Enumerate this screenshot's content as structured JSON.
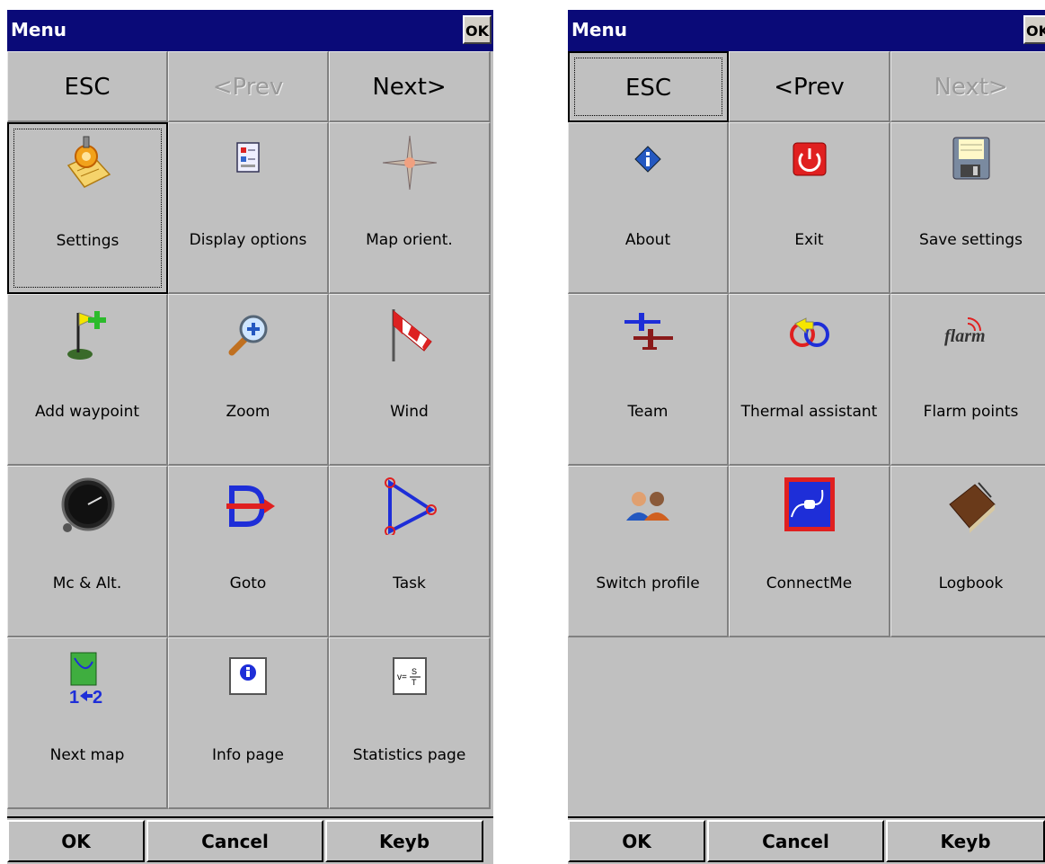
{
  "left": {
    "title": "Menu",
    "ok": "OK",
    "nav": {
      "esc": "ESC",
      "prev": "<Prev",
      "next": "Next>"
    },
    "items": [
      {
        "label": "Settings",
        "icon": "settings-icon"
      },
      {
        "label": "Display options",
        "icon": "display-options-icon"
      },
      {
        "label": "Map orient.",
        "icon": "compass-icon"
      },
      {
        "label": "Add waypoint",
        "icon": "add-waypoint-icon"
      },
      {
        "label": "Zoom",
        "icon": "zoom-icon"
      },
      {
        "label": "Wind",
        "icon": "windsock-icon"
      },
      {
        "label": "Mc & Alt.",
        "icon": "gauge-icon"
      },
      {
        "label": "Goto",
        "icon": "goto-icon"
      },
      {
        "label": "Task",
        "icon": "task-icon"
      },
      {
        "label": "Next map",
        "icon": "next-map-icon"
      },
      {
        "label": "Info page",
        "icon": "info-page-icon"
      },
      {
        "label": "Statistics page",
        "icon": "statistics-icon"
      }
    ],
    "bottom": {
      "ok": "OK",
      "cancel": "Cancel",
      "keyb": "Keyb"
    }
  },
  "right": {
    "title": "Menu",
    "ok": "OK",
    "nav": {
      "esc": "ESC",
      "prev": "<Prev",
      "next": "Next>"
    },
    "items": [
      {
        "label": "About",
        "icon": "about-icon"
      },
      {
        "label": "Exit",
        "icon": "power-icon"
      },
      {
        "label": "Save settings",
        "icon": "floppy-icon"
      },
      {
        "label": "Team",
        "icon": "team-icon"
      },
      {
        "label": "Thermal assistant",
        "icon": "thermal-assistant-icon"
      },
      {
        "label": "Flarm points",
        "icon": "flarm-icon"
      },
      {
        "label": "Switch profile",
        "icon": "profile-icon"
      },
      {
        "label": "ConnectMe",
        "icon": "connect-icon"
      },
      {
        "label": "Logbook",
        "icon": "logbook-icon"
      }
    ],
    "bottom": {
      "ok": "OK",
      "cancel": "Cancel",
      "keyb": "Keyb"
    }
  },
  "colors": {
    "titlebar": "#0a0a78",
    "panel": "#c0c0c0",
    "disabled_text": "#9a9a9a"
  },
  "flarm_icon_text": "flarm"
}
